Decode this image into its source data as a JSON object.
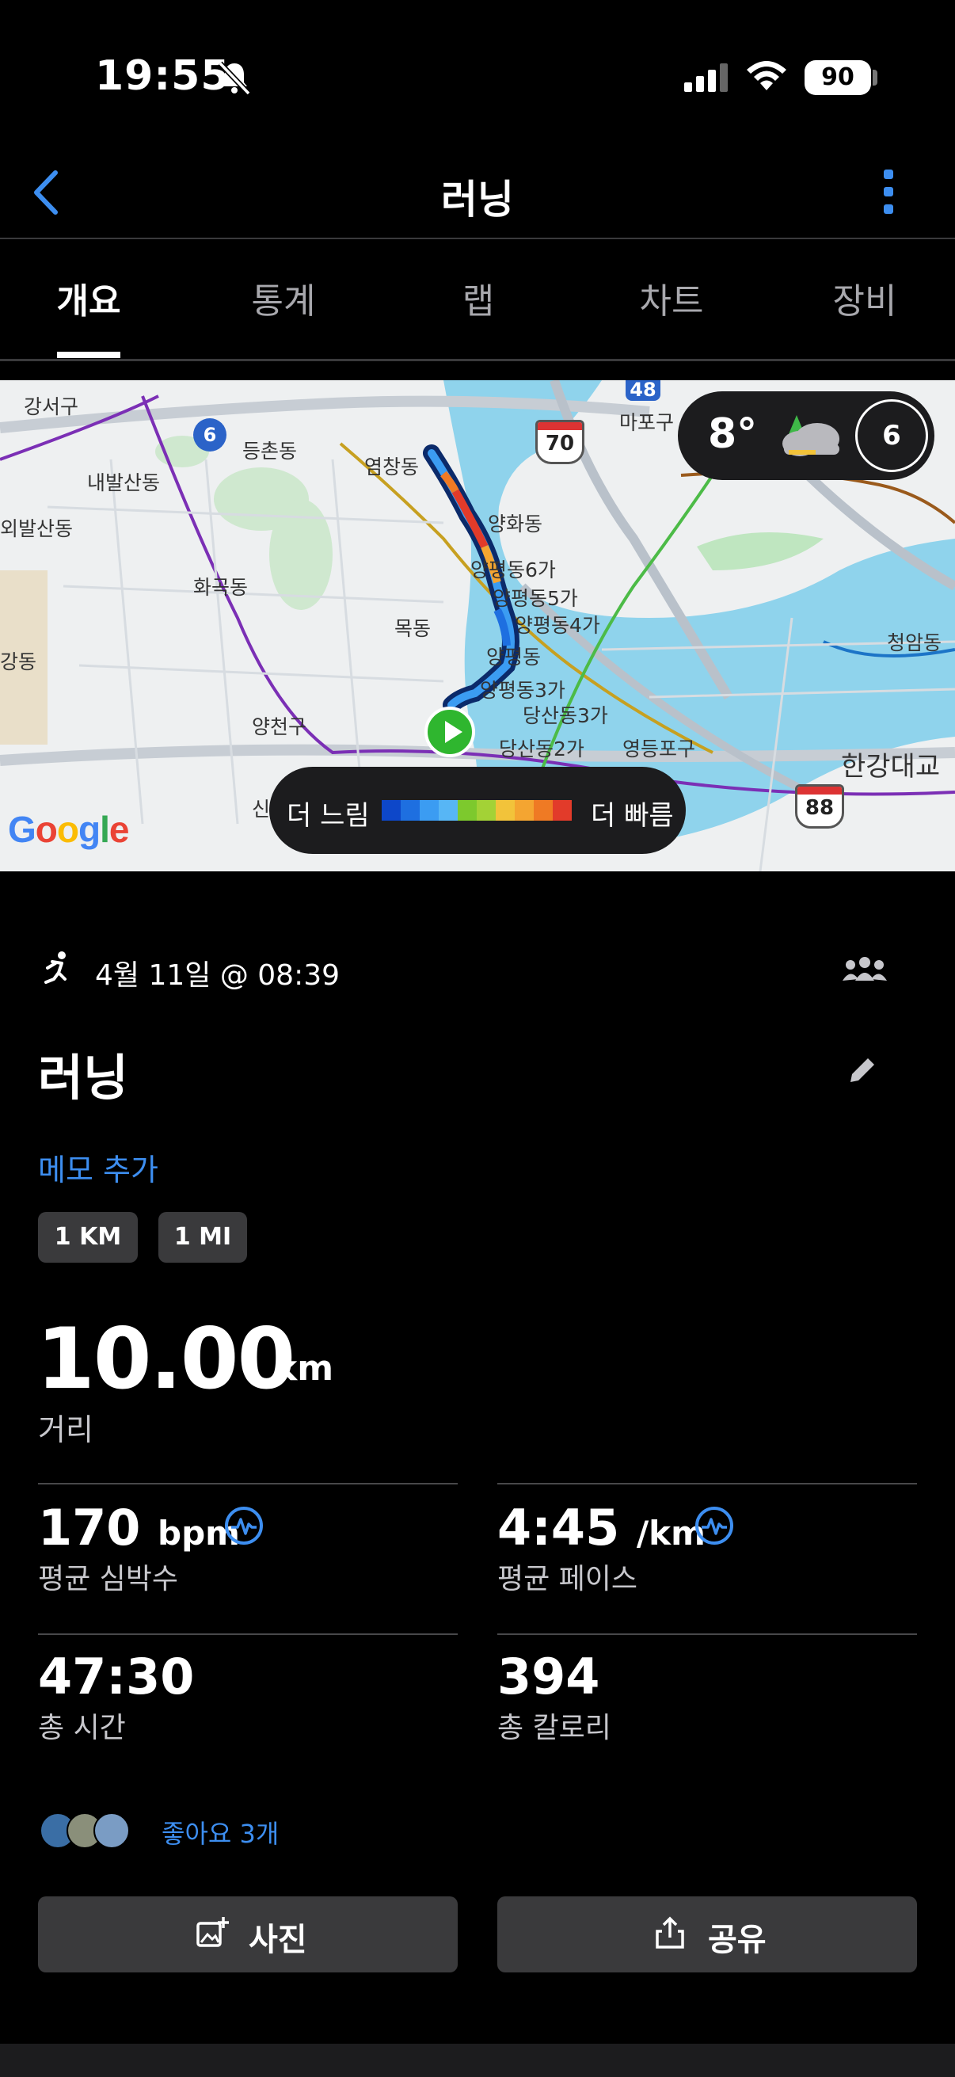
{
  "status": {
    "time": "19:55",
    "battery": "90"
  },
  "nav": {
    "title": "러닝",
    "back_icon": "chevron-left-icon",
    "more_icon": "more-vertical-icon"
  },
  "tabs": [
    {
      "label": "개요",
      "active": true
    },
    {
      "label": "통계",
      "active": false
    },
    {
      "label": "랩",
      "active": false
    },
    {
      "label": "차트",
      "active": false
    },
    {
      "label": "장비",
      "active": false
    }
  ],
  "map": {
    "weather": {
      "temp": "8°",
      "wind": "6",
      "icon": "cloud-icon"
    },
    "legend": {
      "slow": "더 느림",
      "fast": "더 빠름",
      "colors": [
        "#0d47c9",
        "#1e6fe0",
        "#3b9cf2",
        "#57b6f5",
        "#7dc92d",
        "#a3d236",
        "#f2c33a",
        "#f4a531",
        "#ef7a24",
        "#e23b2a"
      ]
    },
    "attribution": "Google",
    "labels": {
      "gangseo": "강서구",
      "naebalsan": "내발산동",
      "oebalsan": "외발산동",
      "gang": "강동",
      "deungchon": "등촌동",
      "yeomchang": "염창동",
      "hwagok": "화곡동",
      "mok": "목동",
      "yangcheon": "양천구",
      "yanghwa": "양화동",
      "yp6": "양평동6가",
      "yp5": "양평동5가",
      "yp4": "양평동4가",
      "yp": "양평동",
      "yp3": "양평동3가",
      "dangsan3": "당산동3가",
      "dangsan2": "당산동2가",
      "yeongdeungpo": "영등포구",
      "mapo": "마포구",
      "cheongam": "청암동",
      "hangang": "한강대교",
      "sin": "신"
    },
    "routes": {
      "r6": "6",
      "r70": "70",
      "r48": "48",
      "r88": "88"
    }
  },
  "activity": {
    "date": "4월 11일 @ 08:39",
    "title": "러닝",
    "add_memo": "메모 추가",
    "unit_chips": [
      "1 KM",
      "1 MI"
    ],
    "distance": {
      "value": "10.00",
      "unit": "km",
      "label": "거리"
    },
    "stats": {
      "hr": {
        "value": "170",
        "unit": "bpm",
        "label": "평균 심박수"
      },
      "pace": {
        "value": "4:45",
        "unit": "/km",
        "label": "평균 페이스"
      },
      "time": {
        "value": "47:30",
        "label": "총 시간"
      },
      "calories": {
        "value": "394",
        "label": "총 칼로리"
      }
    },
    "likes": "좋아요 3개",
    "buttons": {
      "photo": "사진",
      "share": "공유"
    }
  }
}
